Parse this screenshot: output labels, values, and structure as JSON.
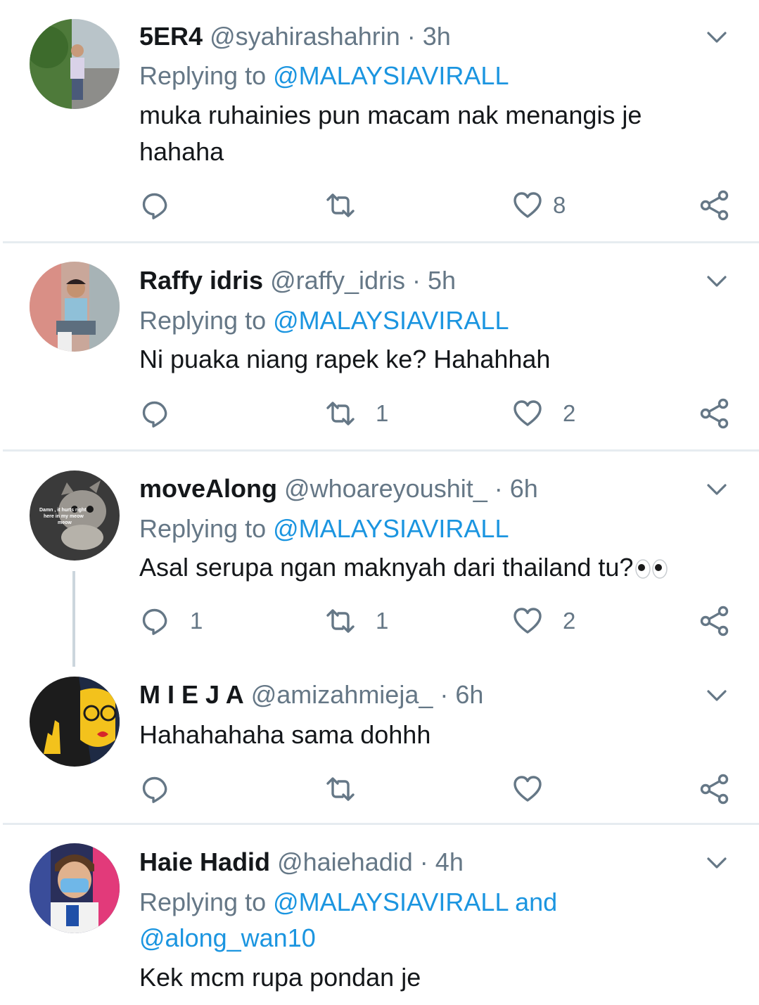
{
  "tweets": [
    {
      "name": "5ER4",
      "handle": "@syahirashahrin",
      "time": "3h",
      "replying_prefix": "Replying to",
      "mentions": "@MALAYSIAVIRALL",
      "text": "muka ruhainies pun macam nak menangis je hahaha",
      "reply_count": "",
      "retweet_count": "",
      "like_count": "8"
    },
    {
      "name": "Raffy idris",
      "handle": "@raffy_idris",
      "time": "5h",
      "replying_prefix": "Replying to",
      "mentions": "@MALAYSIAVIRALL",
      "text": "Ni puaka niang rapek ke? Hahahhah",
      "reply_count": "",
      "retweet_count": "1",
      "like_count": "2"
    },
    {
      "name": "moveAlong",
      "handle": "@whoareyoushit_",
      "time": "6h",
      "replying_prefix": "Replying to",
      "mentions": "@MALAYSIAVIRALL",
      "text": "Asal serupa ngan maknyah dari thailand tu?",
      "reply_count": "1",
      "retweet_count": "1",
      "like_count": "2",
      "avatar_caption": "Damn, it hurts right here in my meow meow"
    },
    {
      "name": "M I E J A",
      "handle": "@amizahmieja_",
      "time": "6h",
      "text": "Hahahahaha sama dohhh",
      "reply_count": "",
      "retweet_count": "",
      "like_count": ""
    },
    {
      "name": "Haie Hadid",
      "handle": "@haiehadid",
      "time": "4h",
      "replying_prefix": "Replying to",
      "mentions": "@MALAYSIAVIRALL and",
      "mentions_2": "@along_wan10",
      "text": "Kek mcm rupa pondan je"
    }
  ],
  "separator": "·",
  "colors": {
    "text": "#14171a",
    "secondary": "#657786",
    "link": "#1b95e0",
    "divider": "#e6ecf0"
  },
  "icons": [
    "reply-icon",
    "retweet-icon",
    "like-icon",
    "share-icon",
    "chevron-down-icon",
    "eyes-emoji-icon"
  ]
}
